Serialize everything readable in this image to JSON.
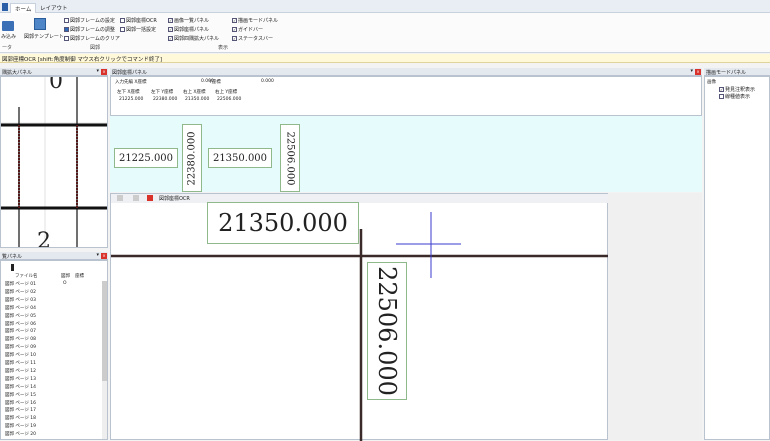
{
  "tabs": {
    "home": "ホーム",
    "layout": "レイアウト"
  },
  "ribbon": {
    "load_label": "み込み",
    "template_label": "図郭テンプレート",
    "frame_settings": "図郭フレームの設定",
    "frame_adjust": "図郭フレームの調整",
    "frame_clear": "図郭フレームのクリア",
    "coord_ocr": "図郭座標OCR",
    "batch_settings": "図郭一括設定",
    "image_list_panel": "画像一覧パネル",
    "coord_panel": "図郭座標パネル",
    "coord_zoom_panel": "図郭四隅拡大パネル",
    "drawing_mode_panel": "描画モードパネル",
    "guide": "ガイドバー",
    "statusbar": "ステータスバー",
    "group_data": "ータ",
    "group_frame": "図郭",
    "group_display": "表示"
  },
  "status_text": "図郭座標OCR [shift:角度制御 マウス右クリックでコマンド終了]",
  "zoom_panel": {
    "title": "隅拡大パネル",
    "labels": [
      "0",
      "2"
    ]
  },
  "image_panel": {
    "title": "覧パネル",
    "col_file": "ファイル名",
    "col_frame": "図郭",
    "col_coord": "座標",
    "rows": [
      "図郭 ページ 01",
      "図郭 ページ 02",
      "図郭 ページ 03",
      "図郭 ページ 04",
      "図郭 ページ 05",
      "図郭 ページ 06",
      "図郭 ページ 07",
      "図郭 ページ 08",
      "図郭 ページ 09",
      "図郭 ページ 10",
      "図郭 ページ 11",
      "図郭 ページ 12",
      "図郭 ページ 13",
      "図郭 ページ 14",
      "図郭 ページ 15",
      "図郭 ページ 16",
      "図郭 ページ 17",
      "図郭 ページ 18",
      "図郭 ページ 19",
      "図郭 ページ 20"
    ],
    "first_row_mark": "O"
  },
  "coord_panel": {
    "title": "図郭座標パネル",
    "input_label": "入力先編 X座標",
    "xval": "0.000",
    "y_label": "Y座標",
    "yval": "0.000",
    "headers": [
      "左下 X座標",
      "左下 Y座標",
      "右上 X座標",
      "右上 Y座標"
    ],
    "values": [
      "21225.000",
      "22380.000",
      "21350.000",
      "22506.000"
    ]
  },
  "ocr": {
    "title": "図郭座標OCR",
    "big_x": "21350.000",
    "big_y": "22506.000",
    "crop": [
      "21225.000",
      "22380.000",
      "21350.000",
      "22506.000"
    ]
  },
  "draw_panel": {
    "title": "描画モードパネル",
    "root": "画像",
    "opt1": "発見注釈表示",
    "opt2": "線種値表示"
  }
}
